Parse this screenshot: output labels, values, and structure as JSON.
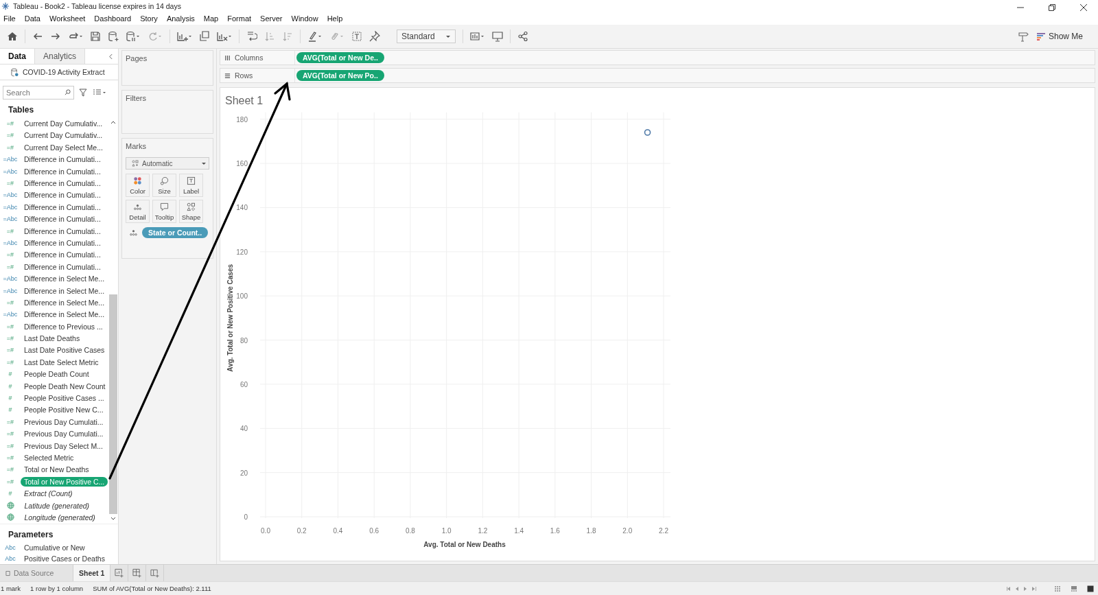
{
  "window": {
    "title": "Tableau - Book2 - Tableau license expires in 14 days"
  },
  "menu": [
    "File",
    "Data",
    "Worksheet",
    "Dashboard",
    "Story",
    "Analysis",
    "Map",
    "Format",
    "Server",
    "Window",
    "Help"
  ],
  "toolbar": {
    "fit_dropdown": "Standard",
    "show_me": "Show Me"
  },
  "data_pane": {
    "tabs": [
      {
        "label": "Data",
        "selected": true
      },
      {
        "label": "Analytics",
        "selected": false
      }
    ],
    "datasource": "COVID-19 Activity Extract",
    "search": {
      "placeholder": "Search"
    },
    "tables_heading": "Tables",
    "fields": [
      {
        "name": "Current Day Cumulativ...",
        "kind": "measure",
        "badge": "=#",
        "generated": false,
        "selected": false
      },
      {
        "name": "Current Day Cumulativ...",
        "kind": "measure",
        "badge": "=#",
        "generated": false,
        "selected": false
      },
      {
        "name": "Current Day Select Me...",
        "kind": "measure",
        "badge": "=#",
        "generated": false,
        "selected": false
      },
      {
        "name": "Difference in Cumulati...",
        "kind": "dimension",
        "badge": "=Abc",
        "generated": false,
        "selected": false
      },
      {
        "name": "Difference in Cumulati...",
        "kind": "dimension",
        "badge": "=Abc",
        "generated": false,
        "selected": false
      },
      {
        "name": "Difference in Cumulati...",
        "kind": "measure",
        "badge": "=#",
        "generated": false,
        "selected": false
      },
      {
        "name": "Difference in Cumulati...",
        "kind": "dimension",
        "badge": "=Abc",
        "generated": false,
        "selected": false
      },
      {
        "name": "Difference in Cumulati...",
        "kind": "dimension",
        "badge": "=Abc",
        "generated": false,
        "selected": false
      },
      {
        "name": "Difference in Cumulati...",
        "kind": "dimension",
        "badge": "=Abc",
        "generated": false,
        "selected": false
      },
      {
        "name": "Difference in Cumulati...",
        "kind": "measure",
        "badge": "=#",
        "generated": false,
        "selected": false
      },
      {
        "name": "Difference in Cumulati...",
        "kind": "dimension",
        "badge": "=Abc",
        "generated": false,
        "selected": false
      },
      {
        "name": "Difference in Cumulati...",
        "kind": "measure",
        "badge": "=#",
        "generated": false,
        "selected": false
      },
      {
        "name": "Difference in Cumulati...",
        "kind": "measure",
        "badge": "=#",
        "generated": false,
        "selected": false
      },
      {
        "name": "Difference in Select Me...",
        "kind": "dimension",
        "badge": "=Abc",
        "generated": false,
        "selected": false
      },
      {
        "name": "Difference in Select Me...",
        "kind": "dimension",
        "badge": "=Abc",
        "generated": false,
        "selected": false
      },
      {
        "name": "Difference in Select Me...",
        "kind": "measure",
        "badge": "=#",
        "generated": false,
        "selected": false
      },
      {
        "name": "Difference in Select Me...",
        "kind": "dimension",
        "badge": "=Abc",
        "generated": false,
        "selected": false
      },
      {
        "name": "Difference to Previous ...",
        "kind": "measure",
        "badge": "=#",
        "generated": false,
        "selected": false
      },
      {
        "name": "Last Date Deaths",
        "kind": "measure",
        "badge": "=#",
        "generated": false,
        "selected": false
      },
      {
        "name": "Last Date Positive Cases",
        "kind": "measure",
        "badge": "=#",
        "generated": false,
        "selected": false
      },
      {
        "name": "Last Date Select Metric",
        "kind": "measure",
        "badge": "=#",
        "generated": false,
        "selected": false
      },
      {
        "name": "People Death Count",
        "kind": "measure",
        "badge": "#",
        "generated": false,
        "selected": false
      },
      {
        "name": "People Death New Count",
        "kind": "measure",
        "badge": "#",
        "generated": false,
        "selected": false
      },
      {
        "name": "People Positive Cases ...",
        "kind": "measure",
        "badge": "#",
        "generated": false,
        "selected": false
      },
      {
        "name": "People Positive New C...",
        "kind": "measure",
        "badge": "#",
        "generated": false,
        "selected": false
      },
      {
        "name": "Previous Day Cumulati...",
        "kind": "measure",
        "badge": "=#",
        "generated": false,
        "selected": false
      },
      {
        "name": "Previous Day Cumulati...",
        "kind": "measure",
        "badge": "=#",
        "generated": false,
        "selected": false
      },
      {
        "name": "Previous Day Select M...",
        "kind": "measure",
        "badge": "=#",
        "generated": false,
        "selected": false
      },
      {
        "name": "Selected Metric",
        "kind": "measure",
        "badge": "=#",
        "generated": false,
        "selected": false
      },
      {
        "name": "Total or New Deaths",
        "kind": "measure",
        "badge": "=#",
        "generated": false,
        "selected": false
      },
      {
        "name": "Total or New Positive C...",
        "kind": "measure",
        "badge": "=#",
        "generated": false,
        "selected": true
      },
      {
        "name": "Extract (Count)",
        "kind": "measure",
        "badge": "#",
        "generated": true,
        "selected": false
      },
      {
        "name": "Latitude (generated)",
        "kind": "geo",
        "generated": true,
        "selected": false
      },
      {
        "name": "Longitude (generated)",
        "kind": "geo",
        "generated": true,
        "selected": false
      }
    ],
    "parameters_heading": "Parameters",
    "parameters": [
      {
        "name": "Cumulative or New",
        "badge": "Abc"
      },
      {
        "name": "Positive Cases or Deaths",
        "badge": "Abc"
      }
    ]
  },
  "cards": {
    "pages": "Pages",
    "filters": "Filters",
    "marks": {
      "title": "Marks",
      "mark_type": "Automatic",
      "buttons": [
        {
          "label": "Color",
          "kind": "color"
        },
        {
          "label": "Size",
          "kind": "size"
        },
        {
          "label": "Label",
          "kind": "label"
        },
        {
          "label": "Detail",
          "kind": "detail"
        },
        {
          "label": "Tooltip",
          "kind": "tooltip"
        },
        {
          "label": "Shape",
          "kind": "shape"
        }
      ],
      "detail_pill": "State or Count.."
    }
  },
  "shelves": [
    {
      "label": "Columns",
      "kind": "columns",
      "pill": "AVG(Total or New De.."
    },
    {
      "label": "Rows",
      "kind": "rows",
      "pill": "AVG(Total or New Po.."
    }
  ],
  "sheet": {
    "title": "Sheet 1",
    "chart_data": {
      "type": "scatter",
      "grid": true,
      "xlabel": "Avg. Total or New Deaths",
      "ylabel": "Avg. Total or New Positive Cases",
      "x": [
        2.111
      ],
      "values": [
        174
      ],
      "xlim": [
        0,
        2.2
      ],
      "ylim": [
        0,
        180
      ],
      "xticks": [
        {
          "value": 0,
          "label": "0.0"
        },
        {
          "value": 0.2,
          "label": "0.2"
        },
        {
          "value": 0.4,
          "label": "0.4"
        },
        {
          "value": 0.6,
          "label": "0.6"
        },
        {
          "value": 0.8,
          "label": "0.8"
        },
        {
          "value": 1,
          "label": "1.0"
        },
        {
          "value": 1.2,
          "label": "1.2"
        },
        {
          "value": 1.4,
          "label": "1.4"
        },
        {
          "value": 1.6,
          "label": "1.6"
        },
        {
          "value": 1.8,
          "label": "1.8"
        },
        {
          "value": 2,
          "label": "2.0"
        },
        {
          "value": 2.2,
          "label": "2.2"
        }
      ],
      "yticks": [
        0,
        20,
        40,
        60,
        80,
        100,
        120,
        140,
        160,
        180
      ]
    }
  },
  "sheet_tabs": [
    {
      "label": "Data Source",
      "kind": "datasource",
      "selected": false
    },
    {
      "label": "Sheet 1",
      "kind": "sheet",
      "selected": true
    }
  ],
  "status_bar": [
    "1 mark",
    "1 row by 1 column",
    "SUM of AVG(Total or New Deaths): 2.111"
  ]
}
